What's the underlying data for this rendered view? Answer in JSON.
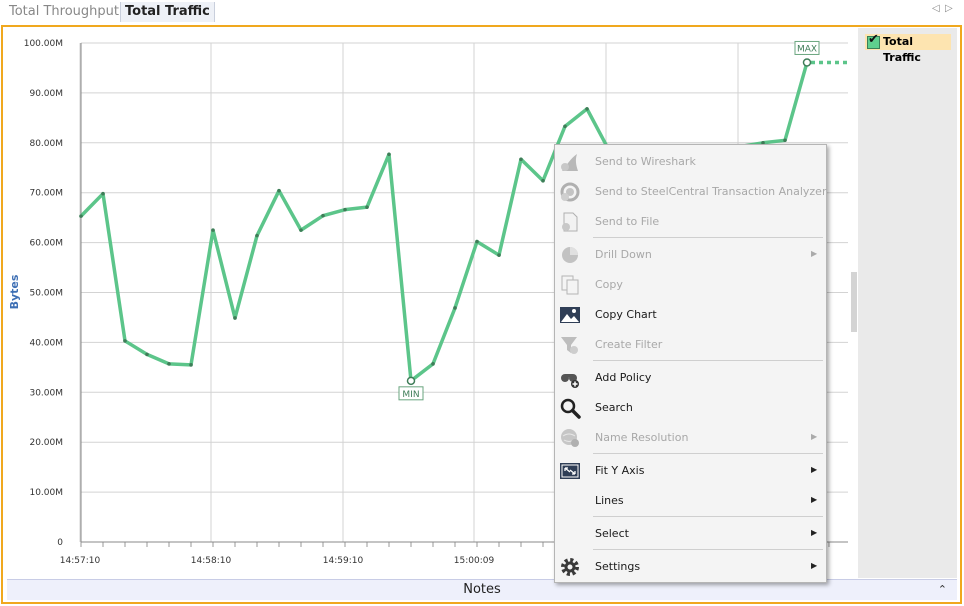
{
  "tabs": [
    {
      "label": "Total Throughput",
      "active": false
    },
    {
      "label": "Total Traffic",
      "active": true
    }
  ],
  "chart_data": {
    "type": "line",
    "ylabel": "Bytes",
    "ylim": [
      0,
      100000000
    ],
    "y_ticks": [
      "0",
      "10.00M",
      "20.00M",
      "30.00M",
      "40.00M",
      "50.00M",
      "60.00M",
      "70.00M",
      "80.00M",
      "90.00M",
      "100.00M"
    ],
    "x_ticks": [
      "14:57:10",
      "14:58:10",
      "14:59:10",
      "15:00:09"
    ],
    "grid": true,
    "series": [
      {
        "name": "Total Traffic",
        "color": "#5cc58a",
        "values": [
          65.3,
          69.8,
          40.3,
          37.6,
          35.7,
          35.5,
          62.5,
          44.9,
          61.4,
          70.4,
          62.5,
          65.4,
          66.6,
          67.1,
          77.7,
          32.3,
          35.7,
          46.9,
          60.2,
          57.5,
          76.7,
          72.4,
          83.3,
          86.8,
          78.5,
          79.3,
          79.3,
          79.3,
          79.3,
          79.3,
          79.3,
          80.0,
          80.5,
          96.1
        ],
        "value_unit": "M"
      }
    ],
    "annotations": [
      {
        "label": "MIN",
        "value": 32.3
      },
      {
        "label": "MAX",
        "value": 96.1
      }
    ],
    "legend": "right"
  },
  "legend": {
    "label": "Total Traffic"
  },
  "context_menu": {
    "items": [
      {
        "label": "Send to Wireshark",
        "icon": "shark-fin-icon",
        "enabled": false,
        "submenu": false
      },
      {
        "label": "Send to SteelCentral Transaction Analyzer",
        "icon": "gear-globe-icon",
        "enabled": false,
        "submenu": false
      },
      {
        "label": "Send to File",
        "icon": "file-add-icon",
        "enabled": false,
        "submenu": false
      },
      {
        "label": "Drill Down",
        "icon": "pie-chart-icon",
        "enabled": false,
        "submenu": true
      },
      {
        "label": "Copy",
        "icon": "copy-icon",
        "enabled": false,
        "submenu": false
      },
      {
        "label": "Copy Chart",
        "icon": "image-icon",
        "enabled": true,
        "submenu": false
      },
      {
        "label": "Create Filter",
        "icon": "filter-icon",
        "enabled": false,
        "submenu": false
      },
      {
        "label": "Add Policy",
        "icon": "binoculars-add-icon",
        "enabled": true,
        "submenu": false
      },
      {
        "label": "Search",
        "icon": "magnifier-icon",
        "enabled": true,
        "submenu": false
      },
      {
        "label": "Name Resolution",
        "icon": "globe-question-icon",
        "enabled": false,
        "submenu": true
      },
      {
        "label": "Fit Y Axis",
        "icon": "fit-axis-icon",
        "enabled": true,
        "submenu": true
      },
      {
        "label": "Lines",
        "icon": "",
        "enabled": true,
        "submenu": true
      },
      {
        "label": "Select",
        "icon": "",
        "enabled": true,
        "submenu": true
      },
      {
        "label": "Settings",
        "icon": "gear-icon",
        "enabled": true,
        "submenu": true
      }
    ]
  },
  "notes": {
    "label": "Notes"
  }
}
